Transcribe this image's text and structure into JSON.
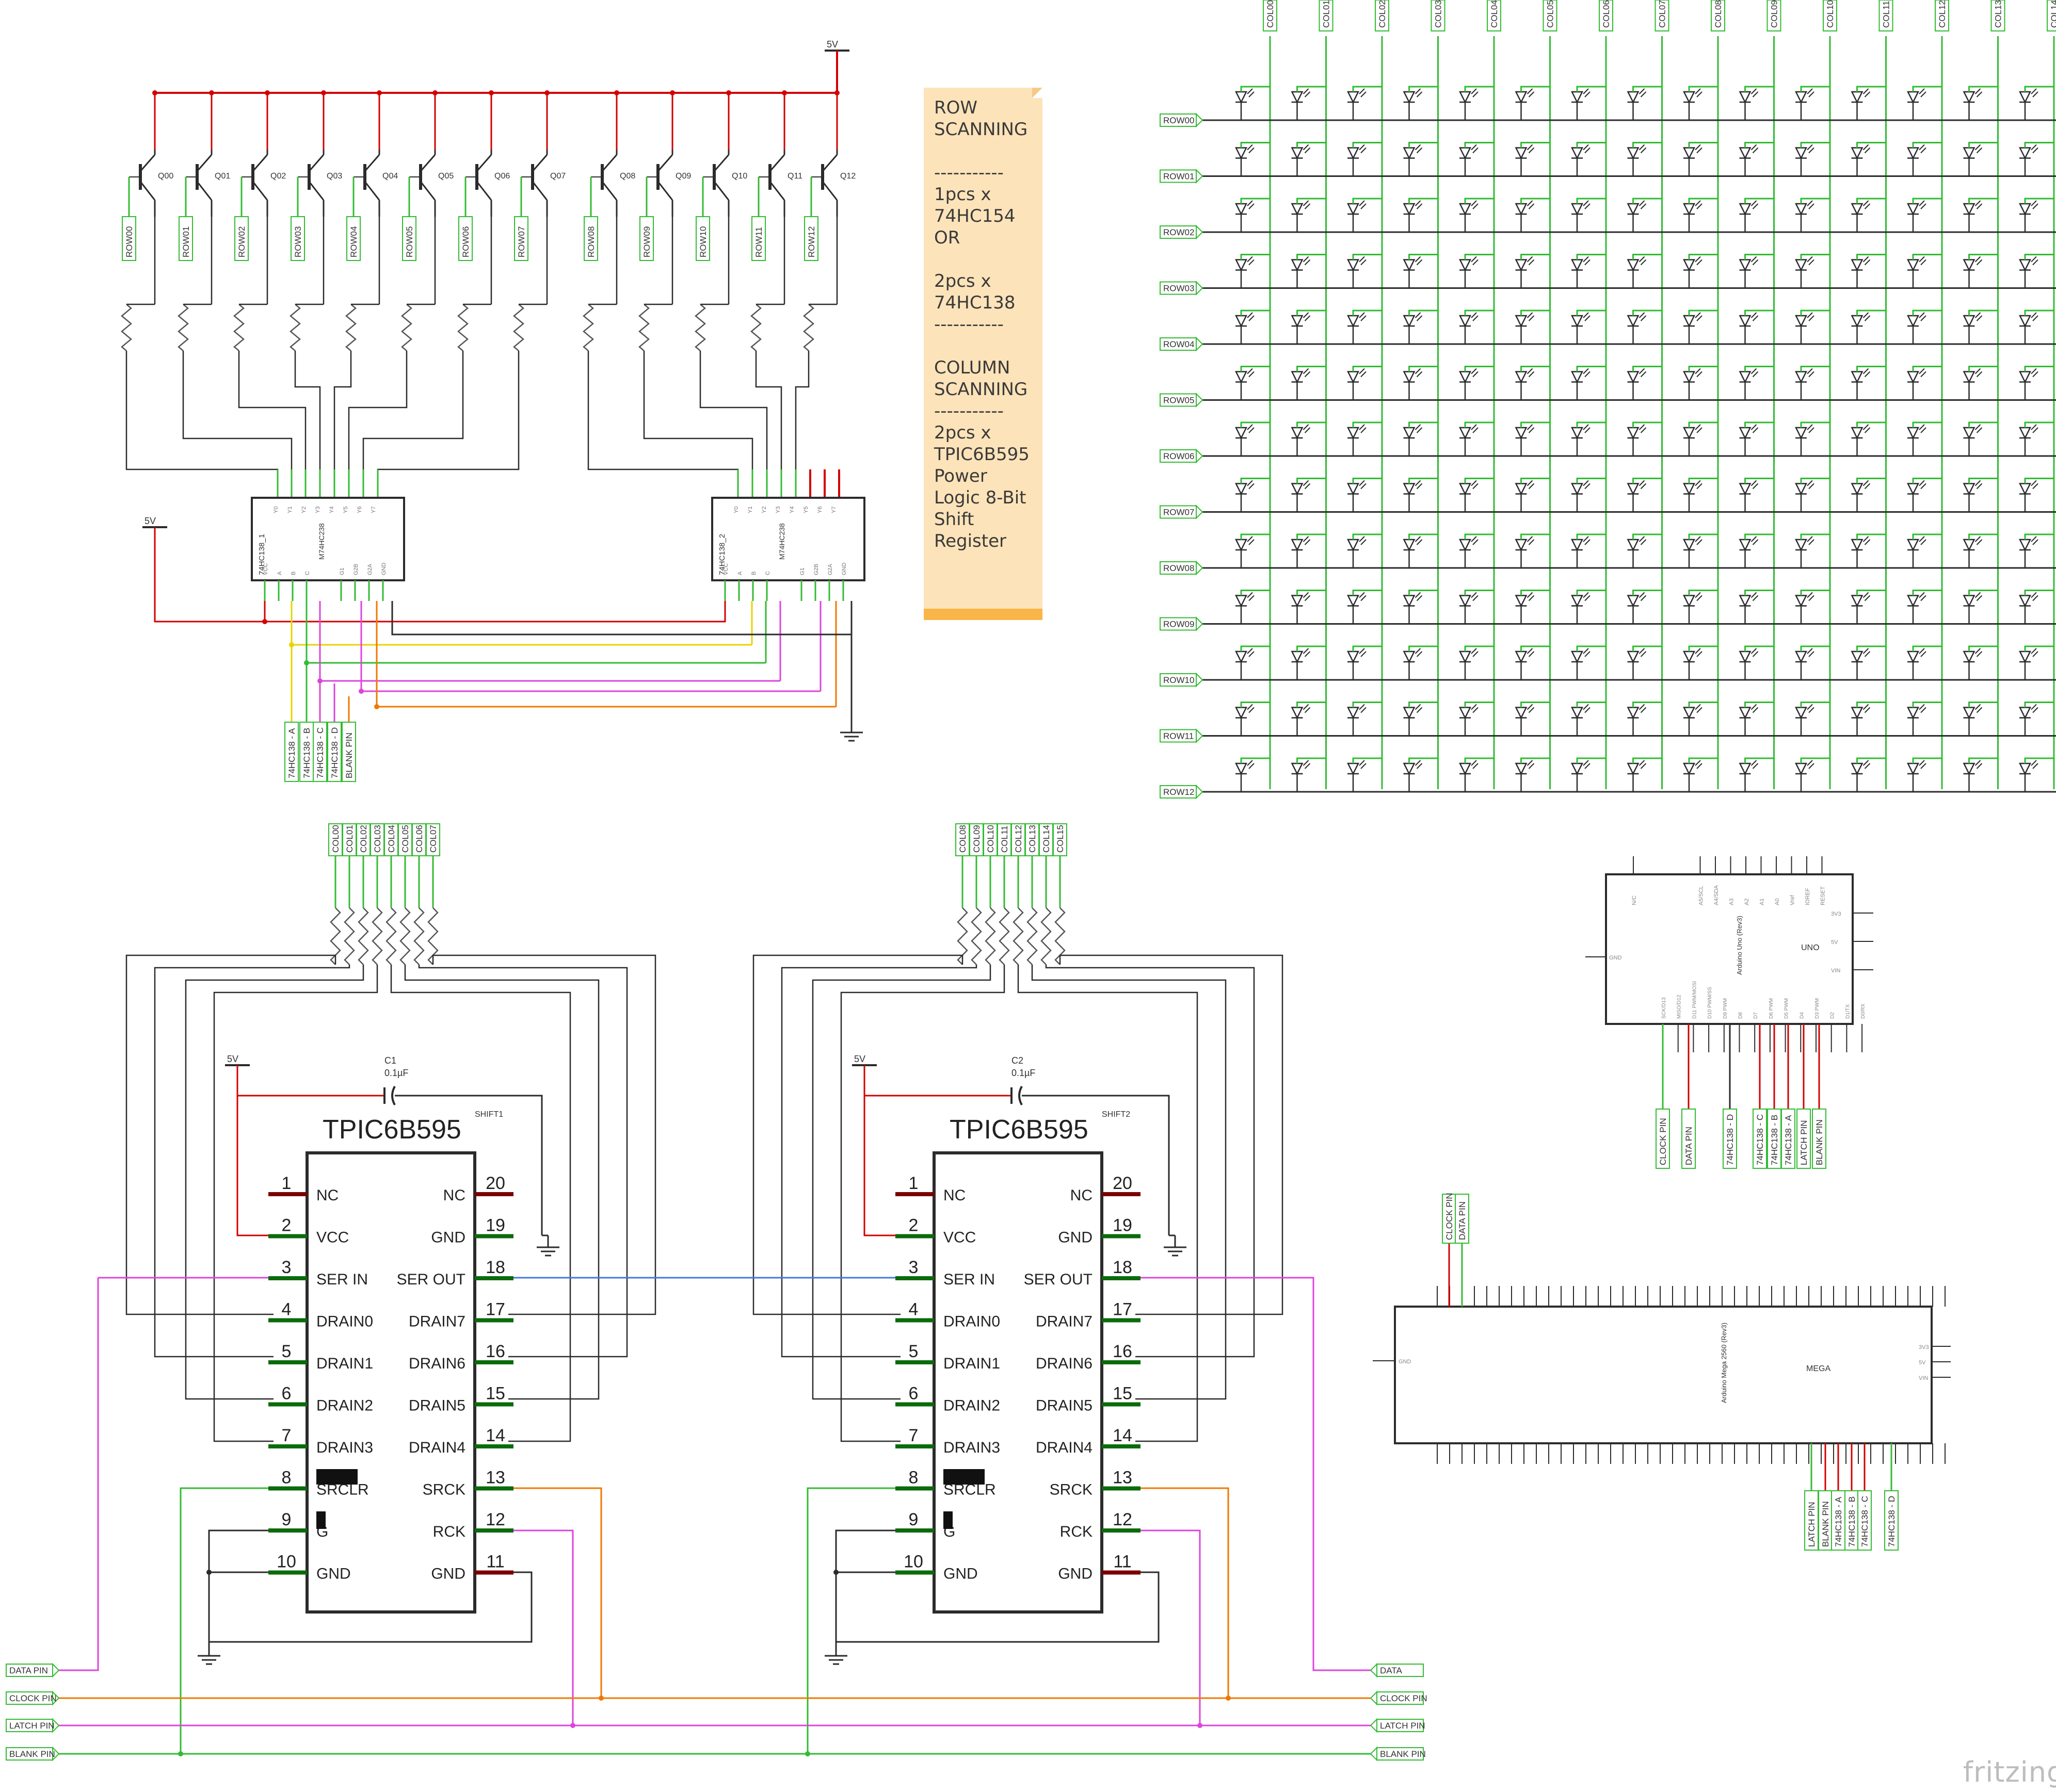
{
  "power": {
    "vcc": "5V"
  },
  "transistors": [
    "Q00",
    "Q01",
    "Q02",
    "Q03",
    "Q04",
    "Q05",
    "Q06",
    "Q07",
    "Q08",
    "Q09",
    "Q10",
    "Q11",
    "Q12"
  ],
  "rows": [
    "ROW00",
    "ROW01",
    "ROW02",
    "ROW03",
    "ROW04",
    "ROW05",
    "ROW06",
    "ROW07",
    "ROW08",
    "ROW09",
    "ROW10",
    "ROW11",
    "ROW12"
  ],
  "cols": [
    "COL00",
    "COL01",
    "COL02",
    "COL03",
    "COL04",
    "COL05",
    "COL06",
    "COL07",
    "COL08",
    "COL09",
    "COL10",
    "COL11",
    "COL12",
    "COL13",
    "COL14"
  ],
  "cols_group1": [
    "COL00",
    "COL01",
    "COL02",
    "COL03",
    "COL04",
    "COL05",
    "COL06",
    "COL07"
  ],
  "cols_group2": [
    "COL08",
    "COL09",
    "COL10",
    "COL11",
    "COL12",
    "COL13",
    "COL14",
    "COL15"
  ],
  "decoders": [
    {
      "id": "74HC138_1",
      "part": "M74HC238",
      "top_pins": [
        "Y0",
        "Y1",
        "Y2",
        "Y3",
        "Y4",
        "Y5",
        "Y6",
        "Y7"
      ],
      "bottom_pins": [
        "VCC",
        "A",
        "B",
        "C",
        "G1",
        "G2B",
        "G2A",
        "GND"
      ]
    },
    {
      "id": "74HC138_2",
      "part": "M74HC238",
      "top_pins": [
        "Y0",
        "Y1",
        "Y2",
        "Y3",
        "Y4",
        "Y5",
        "Y6",
        "Y7"
      ],
      "bottom_pins": [
        "VCC",
        "A",
        "B",
        "C",
        "G1",
        "G2B",
        "G2A",
        "GND"
      ]
    }
  ],
  "decoder_labels": [
    "74HC138 - A",
    "74HC138 - B",
    "74HC138 - C",
    "74HC138 - D",
    "BLANK PIN"
  ],
  "note_lines": [
    "ROW",
    "SCANNING",
    "",
    "-----------",
    "1pcs x",
    "74HC154",
    "OR",
    "",
    "2pcs x",
    "74HC138",
    "-----------",
    "",
    "COLUMN",
    "SCANNING",
    "-----------",
    "2pcs x",
    "TPIC6B595",
    "Power",
    "Logic 8-Bit",
    "Shift",
    "Register"
  ],
  "shift_registers": [
    {
      "name": "TPIC6B595",
      "id": "SHIFT1",
      "cap": "C1",
      "cap_value": "0.1µF"
    },
    {
      "name": "TPIC6B595",
      "id": "SHIFT2",
      "cap": "C2",
      "cap_value": "0.1µF"
    }
  ],
  "sr_left_pins": [
    {
      "num": "1",
      "name": "NC"
    },
    {
      "num": "2",
      "name": "VCC"
    },
    {
      "num": "3",
      "name": "SER IN"
    },
    {
      "num": "4",
      "name": "DRAIN0"
    },
    {
      "num": "5",
      "name": "DRAIN1"
    },
    {
      "num": "6",
      "name": "DRAIN2"
    },
    {
      "num": "7",
      "name": "DRAIN3"
    },
    {
      "num": "8",
      "name": "SRCLR"
    },
    {
      "num": "9",
      "name": "G"
    },
    {
      "num": "10",
      "name": "GND"
    }
  ],
  "sr_right_pins": [
    {
      "num": "20",
      "name": "NC"
    },
    {
      "num": "19",
      "name": "GND"
    },
    {
      "num": "18",
      "name": "SER OUT"
    },
    {
      "num": "17",
      "name": "DRAIN7"
    },
    {
      "num": "16",
      "name": "DRAIN6"
    },
    {
      "num": "15",
      "name": "DRAIN5"
    },
    {
      "num": "14",
      "name": "DRAIN4"
    },
    {
      "num": "13",
      "name": "SRCK"
    },
    {
      "num": "12",
      "name": "RCK"
    },
    {
      "num": "11",
      "name": "GND"
    }
  ],
  "bus_labels_left": [
    "DATA PIN",
    "CLOCK PIN",
    "LATCH PIN",
    "BLANK PIN"
  ],
  "bus_labels_right": [
    "DATA",
    "CLOCK PIN",
    "LATCH PIN",
    "BLANK PIN"
  ],
  "uno": {
    "name": "UNO",
    "board": "Arduino Uno (Rev3)",
    "top_pins": [
      "N/C",
      "A5/SCL",
      "A4/SDA",
      "A3",
      "A2",
      "A1",
      "A0",
      "Vref",
      "IOREF",
      "RESET"
    ],
    "side_pins": [
      "3V3",
      "5V",
      "VIN"
    ],
    "gnd": "GND",
    "bottom_pins": [
      "SCK/D13",
      "MISO/D12",
      "D11 PWM/MOSI",
      "D10 PWM/SS",
      "D9 PWM",
      "D8",
      "D7",
      "D6 PWM",
      "D5 PWM",
      "D4",
      "D3 PWM",
      "D2",
      "D1/TX",
      "D0/RX"
    ],
    "labels": [
      "CLOCK PIN",
      "DATA PIN",
      "74HC138 - D",
      "74HC138 - C",
      "74HC138 - B",
      "74HC138 - A",
      "LATCH PIN",
      "BLANK PIN"
    ]
  },
  "mega": {
    "name": "MEGA",
    "board": "Arduino Mega 2560 (Rev3)",
    "top_labels": [
      "DATA PIN",
      "CLOCK PIN"
    ],
    "side_pins": [
      "3V3",
      "5V",
      "VIN"
    ],
    "gnd": "GND",
    "bottom_labels": [
      "LATCH PIN",
      "BLANK PIN",
      "74HC138 - A",
      "74HC138 - B",
      "74HC138 - C",
      "74HC138 - D"
    ]
  },
  "brand": "fritzing",
  "colors": {
    "red": "#d40000",
    "green": "#33bb33",
    "black": "#2b2b2b",
    "yellow": "#e6d400",
    "magenta": "#dd44dd",
    "orange": "#f07800",
    "blue": "#4477dd",
    "darkgreen": "#0a6b0a",
    "darkred": "#7a0000"
  }
}
